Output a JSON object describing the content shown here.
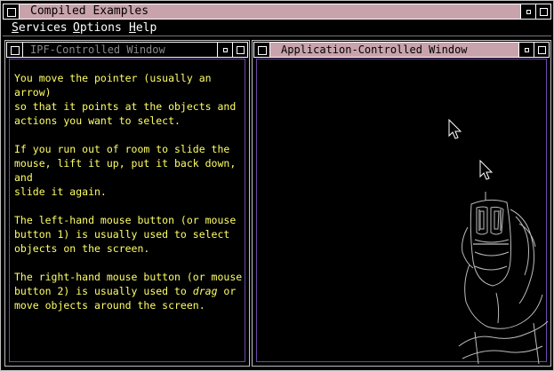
{
  "window": {
    "title": "Compiled Examples"
  },
  "menu": {
    "services": {
      "key": "S",
      "rest": "ervices"
    },
    "options": {
      "key": "O",
      "rest": "ptions"
    },
    "help": {
      "key": "H",
      "rest": "elp"
    }
  },
  "left_pane": {
    "title": "IPF-Controlled Window",
    "p1": "You move the pointer (usually an arrow)\nso that it points at the objects and\nactions you want to select.",
    "p2": "If you run out of room to slide the\nmouse, lift it up, put it back down, and\nslide it again.",
    "p3": "The left-hand mouse button (or mouse\nbutton 1) is usually used to select\nobjects on the screen.",
    "p4_a": "The right-hand mouse button (or mouse\nbutton 2) is usually used to ",
    "p4_em": "drag",
    "p4_b": " or\nmove objects around the screen."
  },
  "right_pane": {
    "title": "Application-Controlled Window"
  },
  "colors": {
    "title_active": "#c9a3ac",
    "ipf_text": "#ffff66",
    "inner_border": "#6b4aa8"
  }
}
